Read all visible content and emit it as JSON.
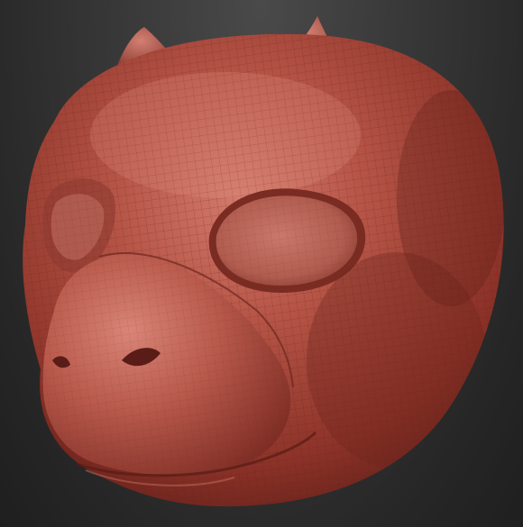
{
  "scene": {
    "subject": "sculpted-creature-head-mask",
    "material_color": "#a8473a",
    "background_color": "#2a2a2a"
  }
}
